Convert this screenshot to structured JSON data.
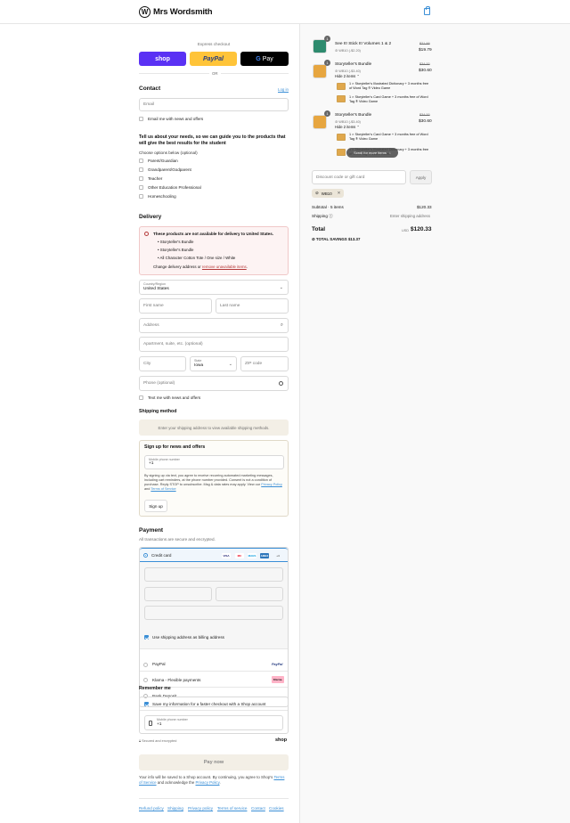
{
  "header": {
    "brand": "Mrs Wordsmith",
    "logo_letter": "W",
    "cart_icon": "bag-icon"
  },
  "express": {
    "label": "Express checkout",
    "shop": "shop",
    "paypal": "PayPal",
    "gpay_g": "G",
    "gpay": "Pay",
    "or": "OR"
  },
  "contact": {
    "title": "Contact",
    "login": "Log in",
    "email_placeholder": "Email",
    "email_news": "Email me with news and offers"
  },
  "survey": {
    "question": "Tell us about your needs, so we can guide you to the products that will give the best results for the student",
    "hint": "Choose options below (optional)",
    "options": [
      "Parent/Guardian",
      "Grandparent/Godparent",
      "Teacher",
      "Other Education Professional",
      "Homeschooling"
    ]
  },
  "delivery": {
    "title": "Delivery",
    "alert_title": "These products are not available for delivery to United States.",
    "alert_items": [
      "Storyteller's Bundle",
      "Storyteller's Bundle",
      "All Character Cotton Tote / One size / White"
    ],
    "alert_change_prefix": "Change delivery address or ",
    "alert_change_link": "remove unavailable items",
    "alert_change_suffix": ".",
    "country_label": "Country/Region",
    "country_value": "United States",
    "first_name": "First name",
    "last_name": "Last name",
    "address": "Address",
    "apartment": "Apartment, suite, etc. (optional)",
    "city": "City",
    "state_label": "State",
    "state_value": "Iowa",
    "zip": "ZIP code",
    "phone": "Phone (optional)",
    "text_news": "Text me with news and offers"
  },
  "shipping": {
    "title": "Shipping method",
    "note": "Enter your shipping address to view available shipping methods."
  },
  "signup": {
    "title": "Sign up for news and offers",
    "phone_label": "Mobile phone number",
    "phone_value": "+1",
    "legal": "By signing up via text, you agree to receive recurring automated marketing messages, including cart reminders, at the phone number provided. Consent is not a condition of purchase. Reply STOP to unsubscribe. Msg & data rates may apply. View our",
    "privacy": "Privacy Policy",
    "and": "and",
    "terms": "Terms of Service",
    "button": "Sign up"
  },
  "payment": {
    "title": "Payment",
    "subtitle": "All transactions are secure and encrypted.",
    "credit_card": "Credit card",
    "card_logos": [
      "VISA",
      "MC",
      "MAES",
      "AMEX",
      "+4"
    ],
    "billing_same": "Use shipping address as billing address",
    "paypal": "PayPal",
    "paypal_logo": "PayPal",
    "klarna": "Klarna - Flexible payments",
    "klarna_logo": "Klarna.",
    "bank": "Bank Deposit"
  },
  "remember": {
    "title": "Remember me",
    "save_info": "Save my information for a faster checkout with a Shop account",
    "phone_label": "Mobile phone number",
    "phone_value": "+1",
    "secure": "Secured and encrypted",
    "shop": "shop"
  },
  "pay_now": "Pay now",
  "consent": {
    "text": "Your info will be saved to a Shop account. By continuing, you agree to Shop's",
    "terms": "Terms of Service",
    "middle": "and acknowledge the",
    "privacy": "Privacy Policy",
    "end": "."
  },
  "footer": [
    "Refund policy",
    "Shipping",
    "Privacy policy",
    "Terms of service",
    "Contact",
    "Cookies"
  ],
  "summary": {
    "items": [
      {
        "qty": "1",
        "title": "See It! Stick It! Volumes 1 & 2",
        "code": "WB10 (-$2.20)",
        "old_price": "$21.99",
        "price": "$19.79"
      },
      {
        "qty": "1",
        "title": "Storyteller's Bundle",
        "code": "WB10 (-$3.40)",
        "old_price": "$34.00",
        "price": "$30.60",
        "toggle": "Hide 2 items",
        "children": [
          "1 × Storyteller's Illustrated Dictionary + 3 months free of Word Tag ® Video Game",
          "1 × Storyteller's Card Game + 3 months free of Word Tag ® Video Game"
        ]
      },
      {
        "qty": "1",
        "title": "Storyteller's Bundle",
        "code": "WB10 (-$3.40)",
        "old_price": "$34.00",
        "price": "$30.60",
        "toggle": "Hide 2 items",
        "children": [
          "1 × Storyteller's Card Game + 3 months free of Word Tag ® Video Game",
          "1 × Storyteller's Illustrated Dictionary + 3 months free of Word Tag ® Video Game"
        ]
      }
    ],
    "scroll_hint": "Scroll for more items",
    "discount_placeholder": "Discount code or gift card",
    "apply": "Apply",
    "tag": "WB10",
    "subtotal_label": "Subtotal · 5 items",
    "subtotal": "$120.33",
    "shipping_label": "Shipping",
    "shipping_value": "Enter shipping address",
    "total_label": "Total",
    "currency": "USD",
    "total": "$120.33",
    "savings_label": "TOTAL SAVINGS",
    "savings": "$13.37"
  }
}
